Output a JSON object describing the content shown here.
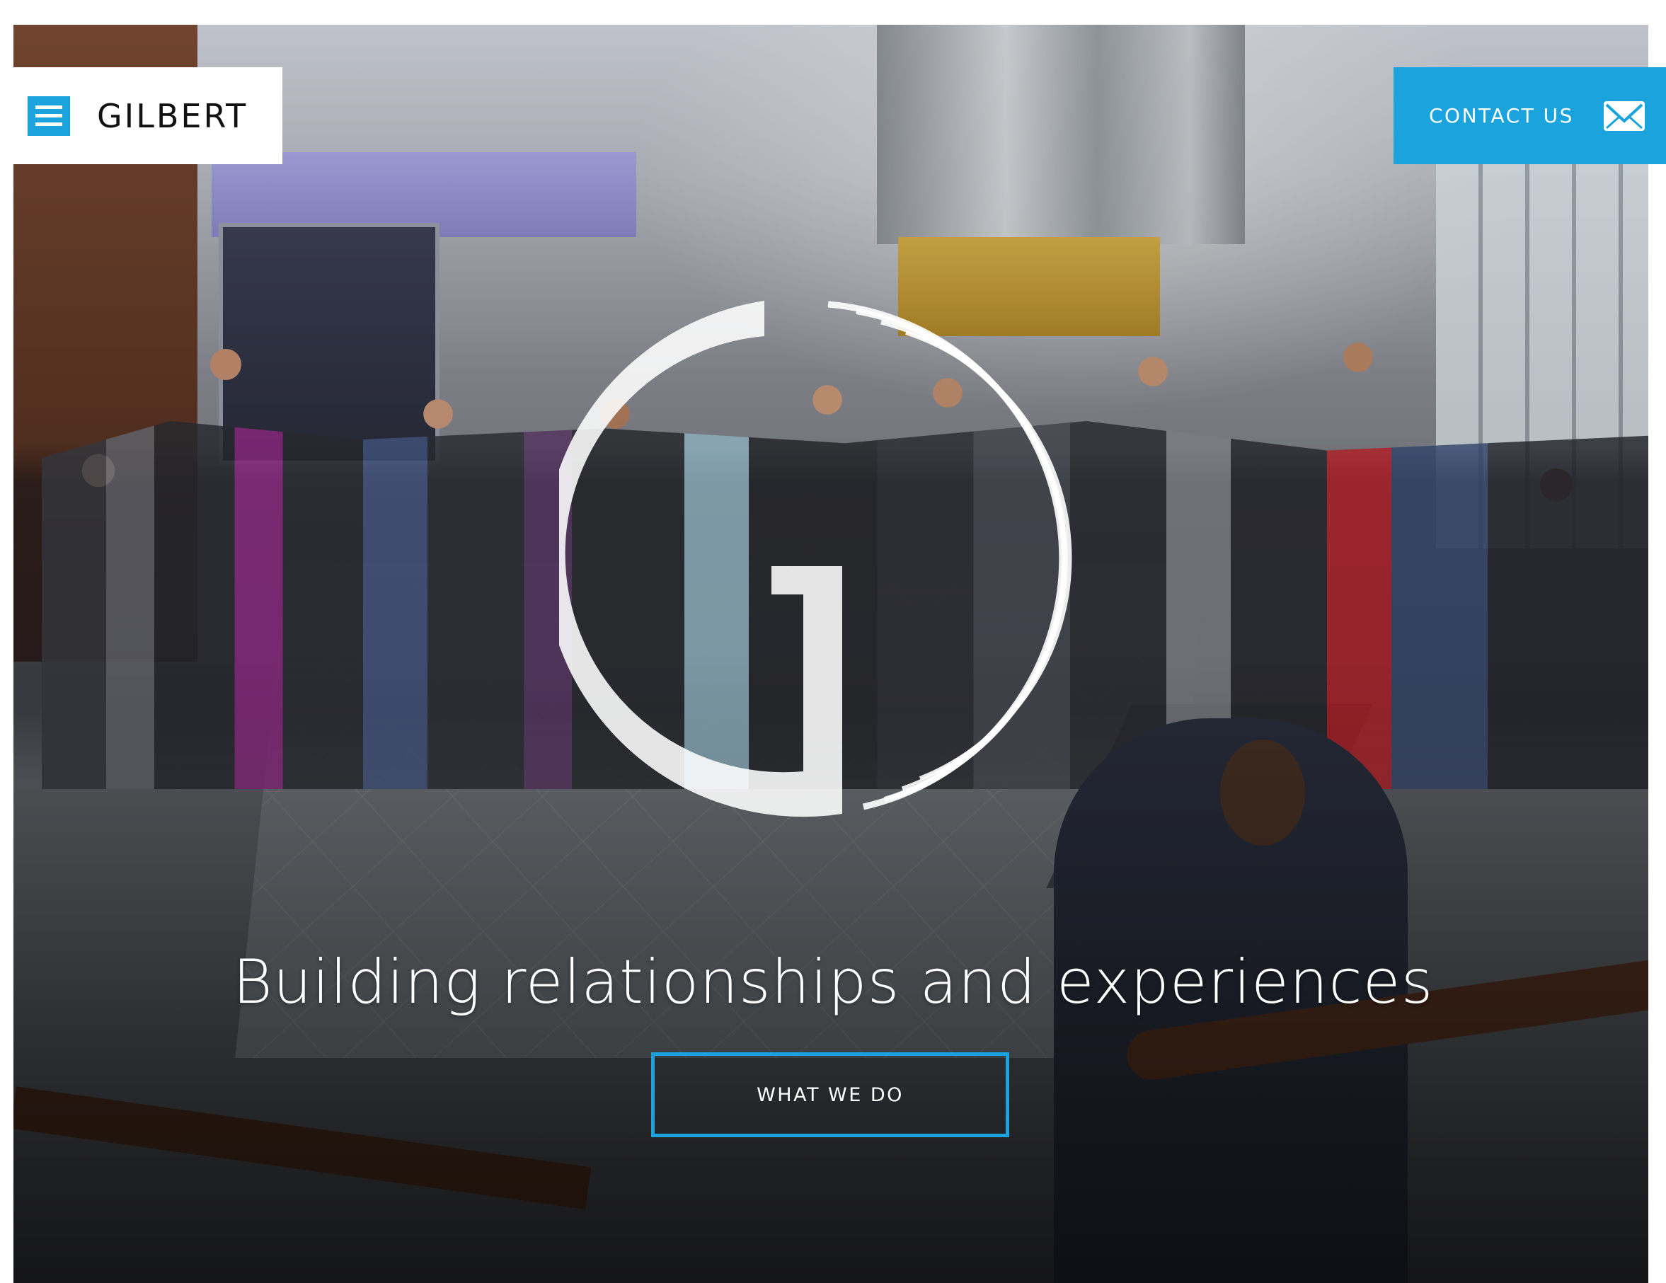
{
  "header": {
    "brand": "GILBERT",
    "menu_icon": "hamburger-menu-icon",
    "contact_label": "CONTACT US",
    "contact_icon": "mail-icon"
  },
  "hero": {
    "headline": "Building relationships and experiences",
    "cta_label": "WHAT WE DO"
  },
  "colors": {
    "accent": "#1aa3dc",
    "text_light": "#ffffff",
    "brand_text": "#111111"
  }
}
